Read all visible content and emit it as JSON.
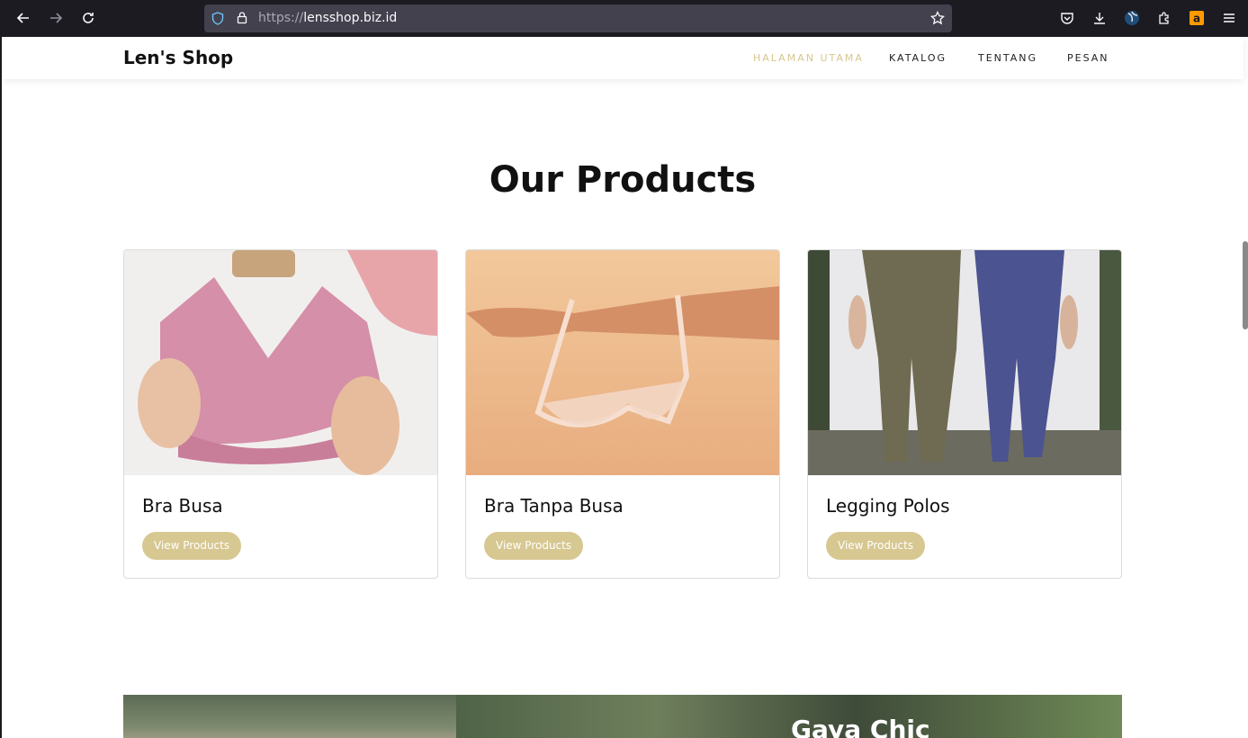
{
  "browser": {
    "url_scheme": "https://",
    "url_host": "lensshop.biz.id"
  },
  "site": {
    "logo": "Len's Shop",
    "menu": [
      {
        "label": "HALAMAN UTAMA",
        "active": true
      },
      {
        "label": "KATALOG",
        "active": false
      },
      {
        "label": "TENTANG",
        "active": false
      },
      {
        "label": "PESAN",
        "active": false
      }
    ]
  },
  "products": {
    "title": "Our Products",
    "items": [
      {
        "name": "Bra Busa",
        "button": "View Products"
      },
      {
        "name": "Bra Tanpa Busa",
        "button": "View Products"
      },
      {
        "name": "Legging Polos",
        "button": "View Products"
      }
    ]
  },
  "banner": {
    "title": "Gaya Chic"
  },
  "colors": {
    "accent": "#d7c791",
    "active_menu": "#d6c68f",
    "chrome_bg": "#1c1b22",
    "urlbar_bg": "#42414d"
  }
}
